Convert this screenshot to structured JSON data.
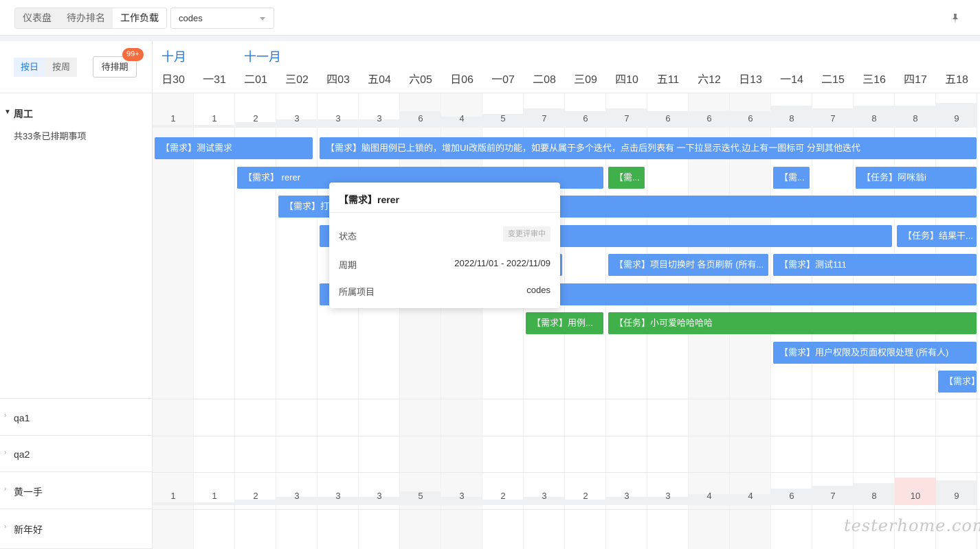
{
  "topbar": {
    "tabs": [
      {
        "label": "仪表盘"
      },
      {
        "label": "待办排名"
      },
      {
        "label": "工作负载"
      }
    ],
    "project_select": "codes"
  },
  "controls": {
    "by_day": "按日",
    "by_week": "按周",
    "unscheduled": "待排期",
    "badge": "99+"
  },
  "months": [
    "十月",
    "十一月"
  ],
  "days": [
    {
      "wd": "日",
      "d": "30",
      "weekend": true
    },
    {
      "wd": "一",
      "d": "31",
      "weekend": false
    },
    {
      "wd": "二",
      "d": "01",
      "weekend": false
    },
    {
      "wd": "三",
      "d": "02",
      "weekend": false
    },
    {
      "wd": "四",
      "d": "03",
      "weekend": false
    },
    {
      "wd": "五",
      "d": "04",
      "weekend": false
    },
    {
      "wd": "六",
      "d": "05",
      "weekend": true
    },
    {
      "wd": "日",
      "d": "06",
      "weekend": true
    },
    {
      "wd": "一",
      "d": "07",
      "weekend": false
    },
    {
      "wd": "二",
      "d": "08",
      "weekend": false
    },
    {
      "wd": "三",
      "d": "09",
      "weekend": false
    },
    {
      "wd": "四",
      "d": "10",
      "weekend": false
    },
    {
      "wd": "五",
      "d": "11",
      "weekend": false
    },
    {
      "wd": "六",
      "d": "12",
      "weekend": true
    },
    {
      "wd": "日",
      "d": "13",
      "weekend": true
    },
    {
      "wd": "一",
      "d": "14",
      "weekend": false
    },
    {
      "wd": "二",
      "d": "15",
      "weekend": false
    },
    {
      "wd": "三",
      "d": "16",
      "weekend": false
    },
    {
      "wd": "四",
      "d": "17",
      "weekend": false
    },
    {
      "wd": "五",
      "d": "18",
      "weekend": false
    }
  ],
  "lanes": [
    {
      "name": "周工",
      "expanded": true,
      "subtitle": "共33条已排期事项",
      "counts": [
        1,
        1,
        2,
        3,
        3,
        3,
        6,
        4,
        5,
        7,
        6,
        7,
        6,
        6,
        6,
        8,
        7,
        8,
        8,
        9
      ]
    },
    {
      "name": "qa1",
      "expanded": false
    },
    {
      "name": "qa2",
      "expanded": false
    },
    {
      "name": "黄一手",
      "expanded": false,
      "counts": [
        1,
        1,
        2,
        3,
        3,
        3,
        5,
        3,
        2,
        3,
        2,
        3,
        3,
        4,
        4,
        6,
        7,
        8,
        10,
        9
      ]
    },
    {
      "name": "新年好",
      "expanded": false
    }
  ],
  "bars": [
    {
      "label": "【需求】测试需求",
      "row": 0,
      "start": 0,
      "end": 3.9,
      "color": "blue"
    },
    {
      "label": "【需求】脑图用例已上锁的，增加UI改版前的功能，如要从属于多个迭代，点击后列表有 一下拉显示迭代,边上有一图标可 分到其他迭代",
      "row": 0,
      "start": 4,
      "end": 20,
      "color": "blue"
    },
    {
      "label": "【需求】 rerer",
      "row": 1,
      "start": 2,
      "end": 10.95,
      "color": "blue"
    },
    {
      "label": "【需...",
      "row": 1,
      "start": 11,
      "end": 11.95,
      "color": "green"
    },
    {
      "label": "【需...",
      "row": 1,
      "start": 15,
      "end": 15.95,
      "color": "blue"
    },
    {
      "label": "【任务】阿咪翁i",
      "row": 1,
      "start": 17,
      "end": 20,
      "color": "blue"
    },
    {
      "label": "【需求】打",
      "row": 2,
      "start": 3,
      "end": 20,
      "color": "blue"
    },
    {
      "label": "",
      "row": 3,
      "start": 4,
      "end": 17.95,
      "color": "blue"
    },
    {
      "label": "【任务】结果干...",
      "row": 3,
      "start": 18,
      "end": 20,
      "color": "blue"
    },
    {
      "label": "",
      "row": 4,
      "start": 9,
      "end": 9.95,
      "color": "blue"
    },
    {
      "label": "【需求】项目切换时 各页刷新 (所有...",
      "row": 4,
      "start": 11,
      "end": 14.95,
      "color": "blue"
    },
    {
      "label": "【需求】测试111",
      "row": 4,
      "start": 15,
      "end": 20,
      "color": "blue"
    },
    {
      "label": "",
      "row": 5,
      "start": 4,
      "end": 20,
      "color": "blue"
    },
    {
      "label": "【需求】用例...",
      "row": 6,
      "start": 9,
      "end": 10.95,
      "color": "green"
    },
    {
      "label": "【任务】小可爱哈哈哈哈",
      "row": 6,
      "start": 11,
      "end": 20,
      "color": "green"
    },
    {
      "label": "【需求】用户权限及页面权限处理 (所有人)",
      "row": 7,
      "start": 15,
      "end": 20,
      "color": "blue"
    },
    {
      "label": "【需求】",
      "row": 8,
      "start": 19,
      "end": 20,
      "color": "blue"
    }
  ],
  "popover": {
    "title": "【需求】rerer",
    "status_label": "状态",
    "status_value": "变更评审中",
    "period_label": "周期",
    "period_value": "2022/11/01 - 2022/11/09",
    "project_label": "所属项目",
    "project_value": "codes"
  },
  "watermark": "testerhome.com",
  "colors": {
    "accent": "#1a7ee6",
    "bar_blue": "#5b9af5",
    "bar_green": "#3fb04a",
    "badge": "#f56c3f",
    "highlight": "#fde2e2"
  }
}
